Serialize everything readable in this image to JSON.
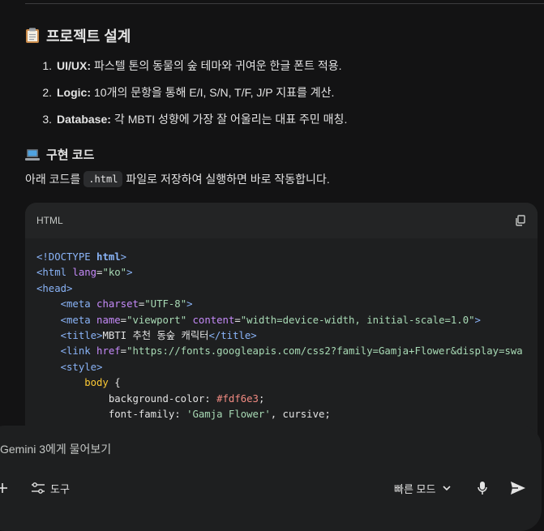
{
  "plan": {
    "icon": "clipboard-emoji-icon",
    "title": "프로젝트 설계",
    "items": [
      {
        "num": "1.",
        "key": "UI/UX:",
        "text": "파스텔 톤의 동물의 숲 테마와 귀여운 한글 폰트 적용."
      },
      {
        "num": "2.",
        "key": "Logic:",
        "text": "10개의 문항을 통해 E/I, S/N, T/F, J/P 지표를 계산."
      },
      {
        "num": "3.",
        "key": "Database:",
        "text": "각 MBTI 성향에 가장 잘 어울리는 대표 주민 매칭."
      }
    ]
  },
  "code_section": {
    "icon": "laptop-emoji-icon",
    "title": "구현 코드",
    "intro_before": "아래 코드를",
    "intro_code": ".html",
    "intro_after": "파일로 저장하여 실행하면 바로 작동합니다."
  },
  "code_block": {
    "language": "HTML",
    "copy_icon": "copy-icon",
    "lines": {
      "l1a": "<!DOCTYPE ",
      "l1b": "html",
      "l1c": ">",
      "l2a": "<html ",
      "l2b": "lang",
      "l2c": "=",
      "l2d": "\"ko\"",
      "l2e": ">",
      "l3": "<head>",
      "l4a": "    <meta ",
      "l4b": "charset",
      "l4c": "=",
      "l4d": "\"UTF-8\"",
      "l4e": ">",
      "l5a": "    <meta ",
      "l5b": "name",
      "l5c": "=",
      "l5d": "\"viewport\"",
      "l5e": " content",
      "l5f": "=",
      "l5g": "\"width=device-width, initial-scale=1.0\"",
      "l5h": ">",
      "l6a": "    <title>",
      "l6b": "MBTI 추천 동숲 캐릭터",
      "l6c": "</title>",
      "l7a": "    <link ",
      "l7b": "href",
      "l7c": "=",
      "l7d": "\"https://fonts.googleapis.com/css2?family=Gamja+Flower&display=swa",
      "l8": "    <style>",
      "l9a": "        body",
      "l9b": " {",
      "l10a": "            background-color: ",
      "l10b": "#fdf6e3",
      "l10c": ";",
      "l11a": "            font-family: ",
      "l11b": "'Gamja Flower'",
      "l11c": ", cursive;"
    }
  },
  "input": {
    "placeholder": "Gemini 3에게 물어보기",
    "tools_label": "도구",
    "mode_label": "빠른 모드"
  },
  "colors": {
    "background": "#131314",
    "surface": "#1e1f20",
    "accent": "#8ab4f8"
  }
}
